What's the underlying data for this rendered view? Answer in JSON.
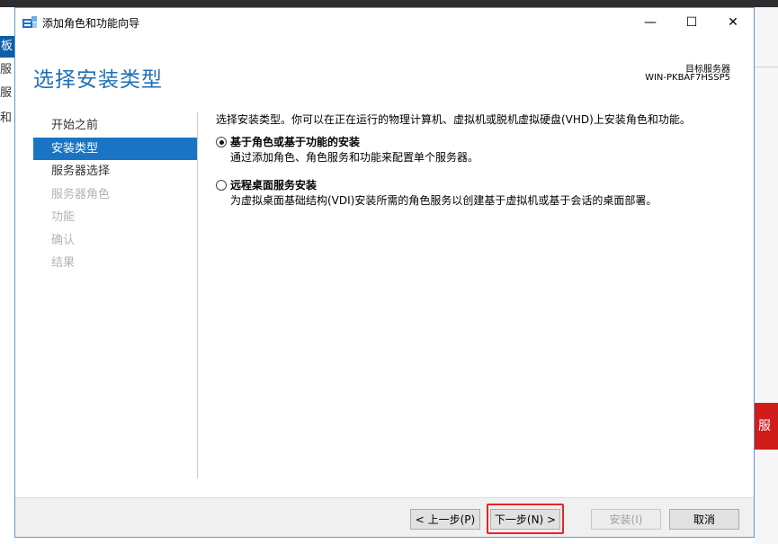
{
  "window": {
    "title": "添加角色和功能向导",
    "minimize": "—",
    "maximize": "☐",
    "close": "✕"
  },
  "header": {
    "page_title": "选择安装类型",
    "dest_label": "目标服务器",
    "dest_server": "WIN-PKBAF7HSSP5"
  },
  "nav": {
    "items": [
      {
        "label": "开始之前",
        "state": "normal"
      },
      {
        "label": "安装类型",
        "state": "active"
      },
      {
        "label": "服务器选择",
        "state": "normal"
      },
      {
        "label": "服务器角色",
        "state": "disabled"
      },
      {
        "label": "功能",
        "state": "disabled"
      },
      {
        "label": "确认",
        "state": "disabled"
      },
      {
        "label": "结果",
        "state": "disabled"
      }
    ]
  },
  "content": {
    "intro": "选择安装类型。你可以在正在运行的物理计算机、虚拟机或脱机虚拟硬盘(VHD)上安装角色和功能。",
    "options": [
      {
        "title": "基于角色或基于功能的安装",
        "desc": "通过添加角色、角色服务和功能来配置单个服务器。",
        "checked": true
      },
      {
        "title": "远程桌面服务安装",
        "desc": "为虚拟桌面基础结构(VDI)安装所需的角色服务以创建基于虚拟机或基于会话的桌面部署。",
        "checked": false
      }
    ]
  },
  "footer": {
    "prev": "< 上一步(P)",
    "next": "下一步(N) >",
    "install": "安装(I)",
    "cancel": "取消"
  },
  "background": {
    "left_texts": [
      "板",
      "服务",
      "服务",
      "和存"
    ],
    "right_text": "服"
  },
  "colors": {
    "accent": "#1a74c4",
    "title_blue": "#1e6fb5",
    "highlight_red": "#e8232a"
  }
}
